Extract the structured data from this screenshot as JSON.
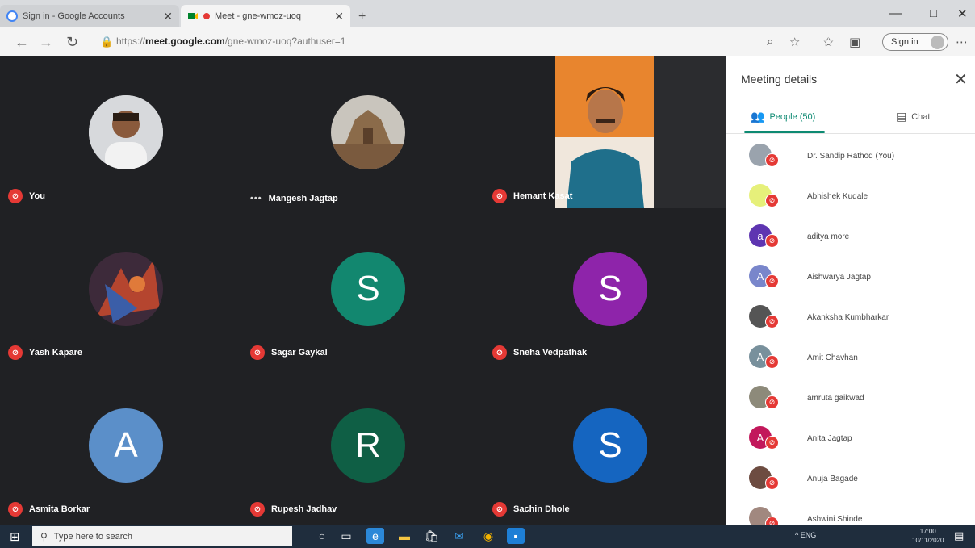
{
  "browser": {
    "tabs": [
      {
        "label": "Sign in - Google Accounts",
        "active": false
      },
      {
        "label": "Meet - gne-wmoz-uoq",
        "active": true,
        "recording": true
      }
    ],
    "url_prefix": "https://",
    "url_domain": "meet.google.com",
    "url_path": "/gne-wmoz-uoq?authuser=1",
    "signin_label": "Sign in",
    "window_controls": {
      "minimize": "—",
      "maximize": "□",
      "close": "✕"
    }
  },
  "meeting": {
    "tiles": [
      {
        "name": "You",
        "avatar": "photo-portrait",
        "muted": true
      },
      {
        "name": "Mangesh Jagtap",
        "avatar": "photo-temple",
        "muted": false,
        "more": "•••"
      },
      {
        "name": "Hemant Kasat",
        "avatar": "video",
        "muted": true
      },
      {
        "name": "Yash Kapare",
        "avatar": "photo-art",
        "muted": true
      },
      {
        "name": "Sagar Gaykal",
        "letter": "S",
        "color": "#12876f",
        "muted": true
      },
      {
        "name": "Sneha Vedpathak",
        "letter": "S",
        "color": "#8e24aa",
        "muted": true
      },
      {
        "name": "Asmita Borkar",
        "letter": "A",
        "color": "#5b8fc9",
        "muted": true
      },
      {
        "name": "Rupesh Jadhav",
        "letter": "R",
        "color": "#0f5f45",
        "muted": true
      },
      {
        "name": "Sachin Dhole",
        "letter": "S",
        "color": "#1565c0",
        "muted": true
      }
    ]
  },
  "panel": {
    "title": "Meeting details",
    "close_icon": "close-icon",
    "tabs": {
      "people": "People (50)",
      "chat": "Chat"
    },
    "people": [
      {
        "name": "Dr. Sandip Rathod (You)",
        "avatar": "photo",
        "color": "#9aa3ad"
      },
      {
        "name": "Abhishek Kudale",
        "letter": "",
        "color": "#e6f07a"
      },
      {
        "name": "aditya more",
        "letter": "a",
        "color": "#5e35b1"
      },
      {
        "name": "Aishwarya Jagtap",
        "letter": "A",
        "color": "#7986cb"
      },
      {
        "name": "Akanksha Kumbharkar",
        "avatar": "photo",
        "color": "#555"
      },
      {
        "name": "Amit Chavhan",
        "letter": "A",
        "color": "#78909c"
      },
      {
        "name": "amruta gaikwad",
        "avatar": "photo",
        "color": "#8d8a7a"
      },
      {
        "name": "Anita Jagtap",
        "letter": "A",
        "color": "#c2185b"
      },
      {
        "name": "Anuja Bagade",
        "avatar": "photo",
        "color": "#6d4c41"
      },
      {
        "name": "Ashwini Shinde",
        "avatar": "photo",
        "color": "#a1887f"
      }
    ]
  },
  "taskbar": {
    "search_placeholder": "Type here to search",
    "tray_text": "^  ENG",
    "time": "17:00",
    "date": "10/11/2020"
  },
  "colors": {
    "meet_bg": "#202124",
    "muted_red": "#e53935",
    "accent_teal": "#0d8a72"
  }
}
